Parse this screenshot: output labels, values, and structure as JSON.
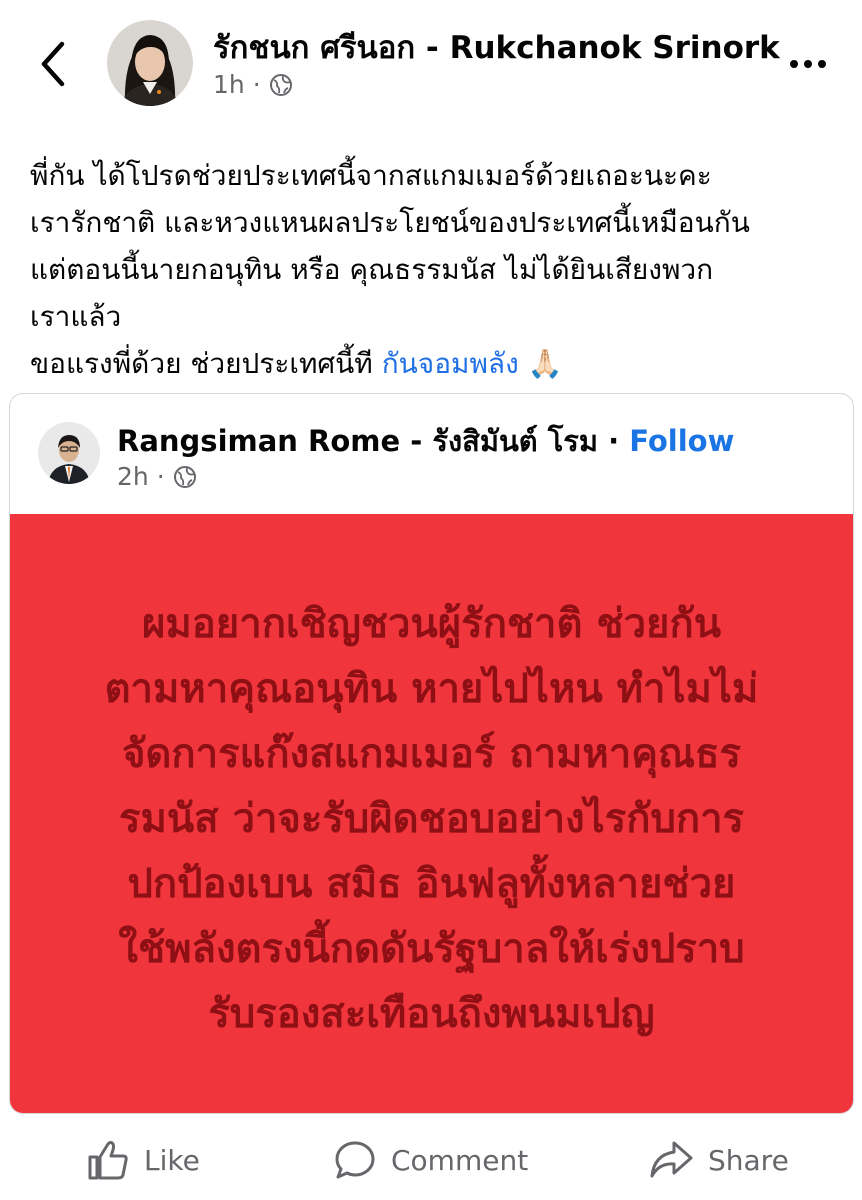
{
  "header": {
    "author_name": "รักชนก ศรีนอก - Rukchanok Srinork",
    "time": "1h",
    "separator": "·"
  },
  "post": {
    "lines": [
      "พี่กัน ได้โปรดช่วยประเทศนี้จากสแกมเมอร์ด้วยเถอะนะคะ",
      "เรารักชาติ และหวงแหนผลประโยชน์ของประเทศนี้เหมือนกัน",
      "แต่ตอนนี้นายกอนุทิน หรือ คุณธรรมนัส ไม่ได้ยินเสียงพวก",
      "เราแล้ว"
    ],
    "last_line": "ขอแรงพี่ด้วย ช่วยประเทศนี้ที",
    "hashtag": "กันจอมพลัง",
    "emoji": "🙏🏻"
  },
  "shared": {
    "author_name": "Rangsiman Rome - รังสิมันต์ โรม",
    "separator": "·",
    "follow_label": "Follow",
    "time": "2h",
    "time_separator": "·",
    "image_lines": [
      "ผมอยากเชิญชวนผู้รักชาติ ช่วยกัน",
      "ตามหาคุณอนุทิน หายไปไหน ทำไมไม่",
      "จัดการแก๊งสแกมเมอร์ ถามหาคุณธร",
      "รมนัส ว่าจะรับผิดชอบอย่างไรกับการ",
      "ปกป้องเบน สมิธ อินฟลูทั้งหลายช่วย",
      "ใช้พลังตรงนี้กดดันรัฐบาลให้เร่งปราบ",
      "รับรองสะเทือนถึงพนมเปญ"
    ]
  },
  "actions": {
    "like": "Like",
    "comment": "Comment",
    "share": "Share"
  },
  "colors": {
    "panel_red": "#f0353c",
    "panel_text": "#8e0f14",
    "link_blue": "#1b74e4"
  }
}
